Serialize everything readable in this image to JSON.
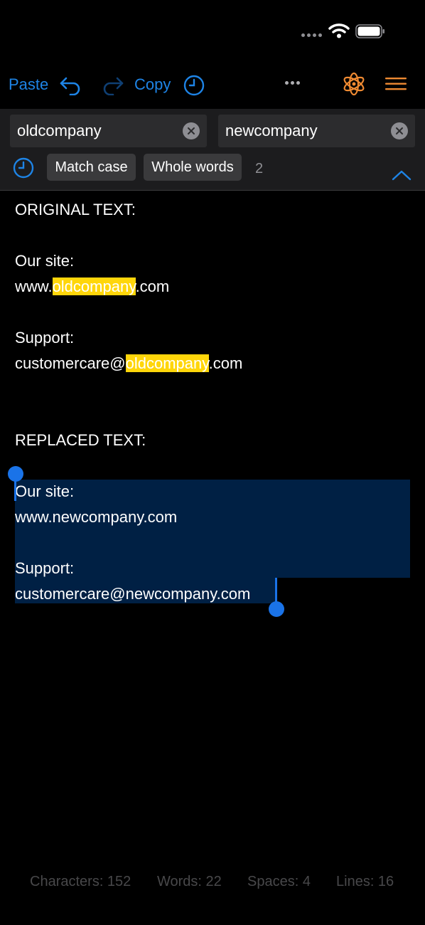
{
  "toolbar": {
    "paste_label": "Paste",
    "copy_label": "Copy",
    "more_label": "•••",
    "accent_color": "#1e84e6",
    "orange_color": "#ef8a32"
  },
  "search": {
    "find_value": "oldcompany",
    "replace_value": "newcompany",
    "match_case_label": "Match case",
    "whole_words_label": "Whole words",
    "match_count": "2"
  },
  "document": {
    "original_header": "ORIGINAL TEXT:",
    "original_site_label": "Our site:",
    "original_site_prefix": "www.",
    "original_site_match": "oldcompany",
    "original_site_suffix": ".com",
    "original_support_label": "Support:",
    "original_support_prefix": "customercare@",
    "original_support_match": "oldcompany",
    "original_support_suffix": ".com",
    "replaced_header": "REPLACED TEXT:",
    "replaced_site_label": "Our site:",
    "replaced_site": "www.newcompany.com",
    "replaced_support_label": "Support:",
    "replaced_support": "customercare@newcompany.com",
    "highlight_color": "#ffd60a"
  },
  "stats": {
    "characters": "Characters: 152",
    "words": "Words: 22",
    "spaces": "Spaces: 4",
    "lines": "Lines: 16"
  }
}
